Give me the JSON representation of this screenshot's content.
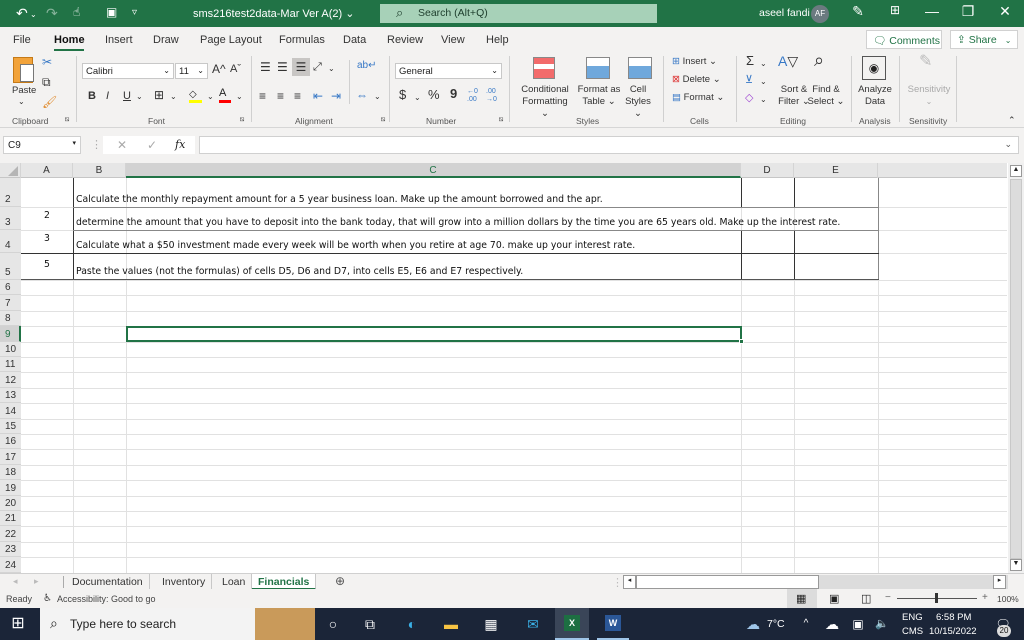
{
  "titlebar": {
    "doc_title": "sms216test2data-Mar Ver A(2) ⌄",
    "search_placeholder": "Search (Alt+Q)",
    "user_name": "aseel fandi",
    "avatar_initials": "AF",
    "undo_icon": "↶",
    "redo_icon": "↷",
    "touch_icon": "☝",
    "save_icon": "💾",
    "customize_icon": "▿",
    "minimize": "—",
    "restore": "❐",
    "close": "✕"
  },
  "menu_tabs": [
    "File",
    "Home",
    "Insert",
    "Draw",
    "Page Layout",
    "Formulas",
    "Data",
    "Review",
    "View",
    "Help"
  ],
  "comments_label": "Comments",
  "share_label": "Share",
  "ribbon": {
    "clipboard": {
      "paste": "Paste",
      "label": "Clipboard"
    },
    "font": {
      "name": "Calibri",
      "size": "11",
      "bold": "B",
      "italic": "I",
      "underline": "U",
      "grow": "A^",
      "shrink": "Aˇ",
      "label": "Font"
    },
    "alignment": {
      "label": "Alignment"
    },
    "number": {
      "format": "General",
      "currency": "$",
      "percent": "%",
      "comma": "9",
      "inc_decimal": "←.0 .00",
      "dec_decimal": ".00 →.0",
      "label": "Number"
    },
    "styles": {
      "conditional": "Conditional",
      "conditional2": "Formatting ⌄",
      "format_as": "Format as",
      "format_as2": "Table ⌄",
      "cell": "Cell",
      "cell2": "Styles ⌄",
      "label": "Styles"
    },
    "cells": {
      "insert": "Insert ⌄",
      "delete": "Delete ⌄",
      "format": "Format ⌄",
      "label": "Cells"
    },
    "editing": {
      "sort": "Sort &",
      "sort2": "Filter ⌄",
      "find": "Find &",
      "find2": "Select ⌄",
      "label": "Editing"
    },
    "analysis": {
      "analyze": "Analyze",
      "analyze2": "Data",
      "label": "Analysis"
    },
    "sensitivity": {
      "btn": "Sensitivity",
      "label": "Sensitivity"
    }
  },
  "formula_bar": {
    "name_box": "C9",
    "cancel": "✕",
    "enter": "✓",
    "fx": "fx",
    "value": ""
  },
  "columns": [
    "A",
    "B",
    "C",
    "D",
    "E"
  ],
  "rows": [
    "2",
    "3",
    "4",
    "5",
    "6",
    "7",
    "8",
    "9",
    "10",
    "11",
    "12",
    "13",
    "14",
    "15",
    "16",
    "17",
    "18",
    "19",
    "20",
    "21",
    "22",
    "23",
    "24"
  ],
  "cells": {
    "A3": "2",
    "A4": "3",
    "A5": "5",
    "B2": "Calculate the monthly repayment amount for a 5 year business loan. Make up the amount borrowed and the apr.",
    "B3": "determine the amount that you have to deposit into the bank today, that will grow into a million dollars by the time you are 65 years old. Make up the interest rate.",
    "B4": "Calculate what a $50 investment made every week will be worth when you retire at age 70.  make up your interest rate.",
    "B5": "Paste the values (not the formulas) of cells D5, D6 and D7, into cells E5, E6 and E7 respectively."
  },
  "selected_cell": "C9",
  "sheet_tabs": [
    "Documentation",
    "Inventory",
    "Loan",
    "Financials"
  ],
  "active_sheet": "Financials",
  "status": {
    "ready": "Ready",
    "accessibility": "Accessibility: Good to go",
    "zoom": "100%"
  },
  "taskbar": {
    "search_placeholder": "Type here to search",
    "weather": "7°C",
    "lang1": "ENG",
    "lang2": "CMS",
    "time": "6:58 PM",
    "date": "10/15/2022",
    "notifications": "20"
  },
  "colors": {
    "excel_green": "#217346",
    "taskbar": "#1b2538"
  }
}
